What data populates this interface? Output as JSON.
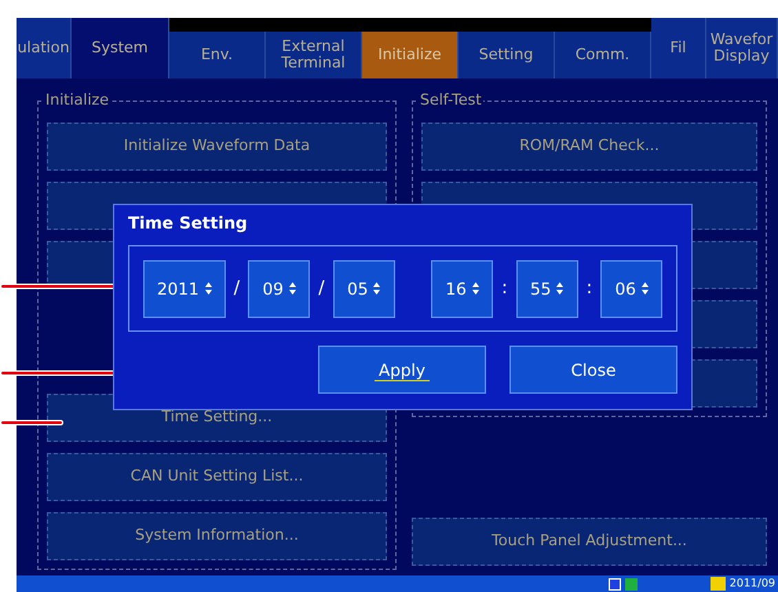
{
  "tabs": [
    {
      "label": "ulation",
      "kind": "main",
      "selected": false
    },
    {
      "label": "System",
      "kind": "main",
      "selected": true
    },
    {
      "label": "Env.",
      "kind": "sub",
      "selected": false
    },
    {
      "label": "External Terminal",
      "kind": "sub",
      "selected": false
    },
    {
      "label": "Initialize",
      "kind": "sub",
      "selected": true
    },
    {
      "label": "Setting",
      "kind": "sub",
      "selected": false
    },
    {
      "label": "Comm.",
      "kind": "sub",
      "selected": false
    },
    {
      "label": "Fil",
      "kind": "main",
      "selected": false
    },
    {
      "label": "Wavefor Display",
      "kind": "main",
      "selected": false
    }
  ],
  "initialize_group": {
    "title": "Initialize",
    "buttons": [
      "Initialize Waveform Data",
      "Time Setting...",
      "CAN Unit Setting List...",
      "System Information..."
    ]
  },
  "self_test_group": {
    "title": "Self-Test",
    "buttons": [
      "ROM/RAM Check..."
    ],
    "extra_button": "Touch Panel Adjustment..."
  },
  "dialog": {
    "title": "Time Setting",
    "fields": [
      {
        "value": "2011",
        "separator": "/"
      },
      {
        "value": "09",
        "separator": "/"
      },
      {
        "value": "05"
      },
      {
        "value": "16",
        "separator": ":"
      },
      {
        "value": "55",
        "separator": ":"
      },
      {
        "value": "06"
      }
    ],
    "buttons": [
      {
        "label": "Apply",
        "focused": true
      },
      {
        "label": "Close",
        "focused": false
      }
    ]
  },
  "taskbar": {
    "clock": "2011/09"
  }
}
